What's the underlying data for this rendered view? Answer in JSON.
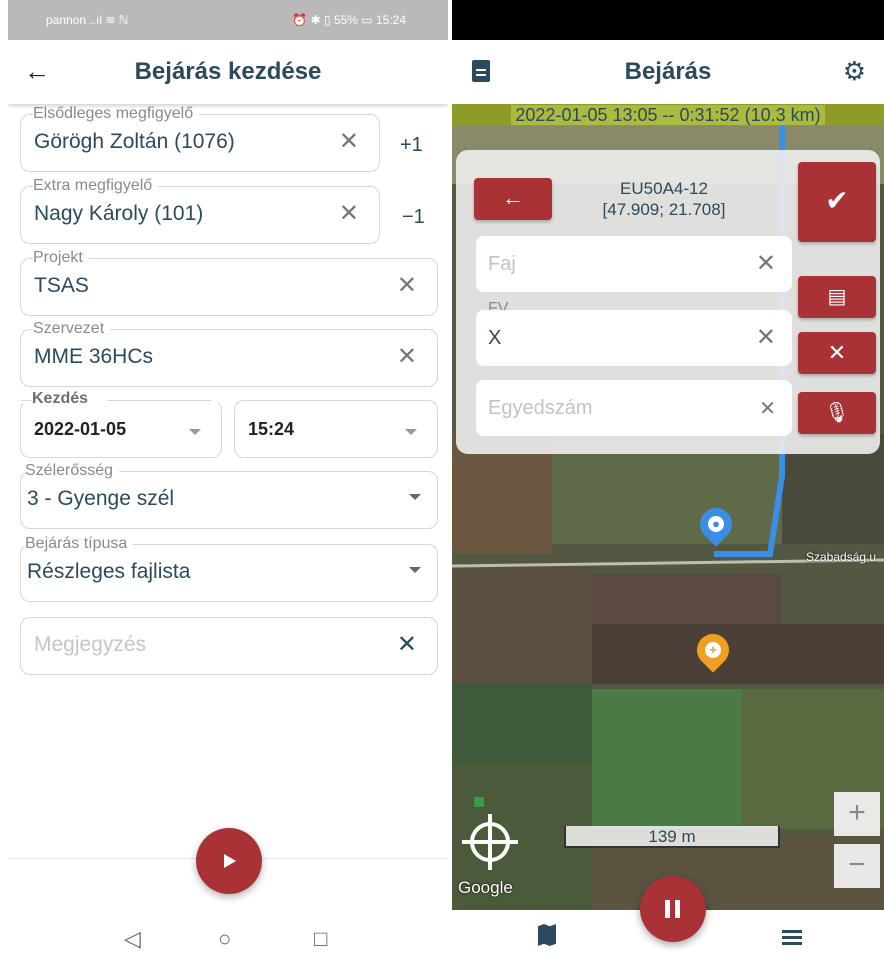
{
  "left": {
    "status": {
      "carrier": "pannon ..ıl ≋ ℕ",
      "right": "⏰ ✱ ▯ 55% ▭ 15:24"
    },
    "appbar": {
      "title": "Bejárás kezdése"
    },
    "fields": {
      "observer1": {
        "label": "Elsődleges megfigyelő",
        "value": "Görögh Zoltán (1076)",
        "side": "+1"
      },
      "observer2": {
        "label": "Extra megfigyelő",
        "value": "Nagy Károly (101)",
        "side": "−1"
      },
      "project": {
        "label": "Projekt",
        "value": "TSAS"
      },
      "org": {
        "label": "Szervezet",
        "value": "MME 36HCs"
      },
      "start": {
        "label": "Kezdés",
        "date": "2022-01-05",
        "time": "15:24"
      },
      "wind": {
        "label": "Szélerősség",
        "value": "3 - Gyenge szél"
      },
      "type": {
        "label": "Bejárás típusa",
        "value": "Részleges fajlista"
      },
      "note": {
        "placeholder": "Megjegyzés"
      }
    },
    "nav": {
      "back": "◁",
      "home": "○",
      "recent": "□"
    }
  },
  "right": {
    "appbar": {
      "title": "Bejárás"
    },
    "route_info": "2022-01-05 13:05 -- 0:31:52 (10.3 km)",
    "panel": {
      "grid": "EU50A4-12",
      "coords": "[47.909; 21.708]",
      "faj": {
        "placeholder": "Faj"
      },
      "fv": {
        "label": "FV",
        "value": "X"
      },
      "egyed": {
        "placeholder": "Egyedszám"
      }
    },
    "map": {
      "scale": "139 m",
      "attribution": "Google",
      "road": "Szabadság u",
      "zoom_in": "+",
      "zoom_out": "−"
    }
  },
  "colors": {
    "accent": "#a93236",
    "text": "#2c4a5e",
    "route": "#3a8ee6",
    "pin_user": "#3a8ee6",
    "pin_add": "#f0a020"
  }
}
